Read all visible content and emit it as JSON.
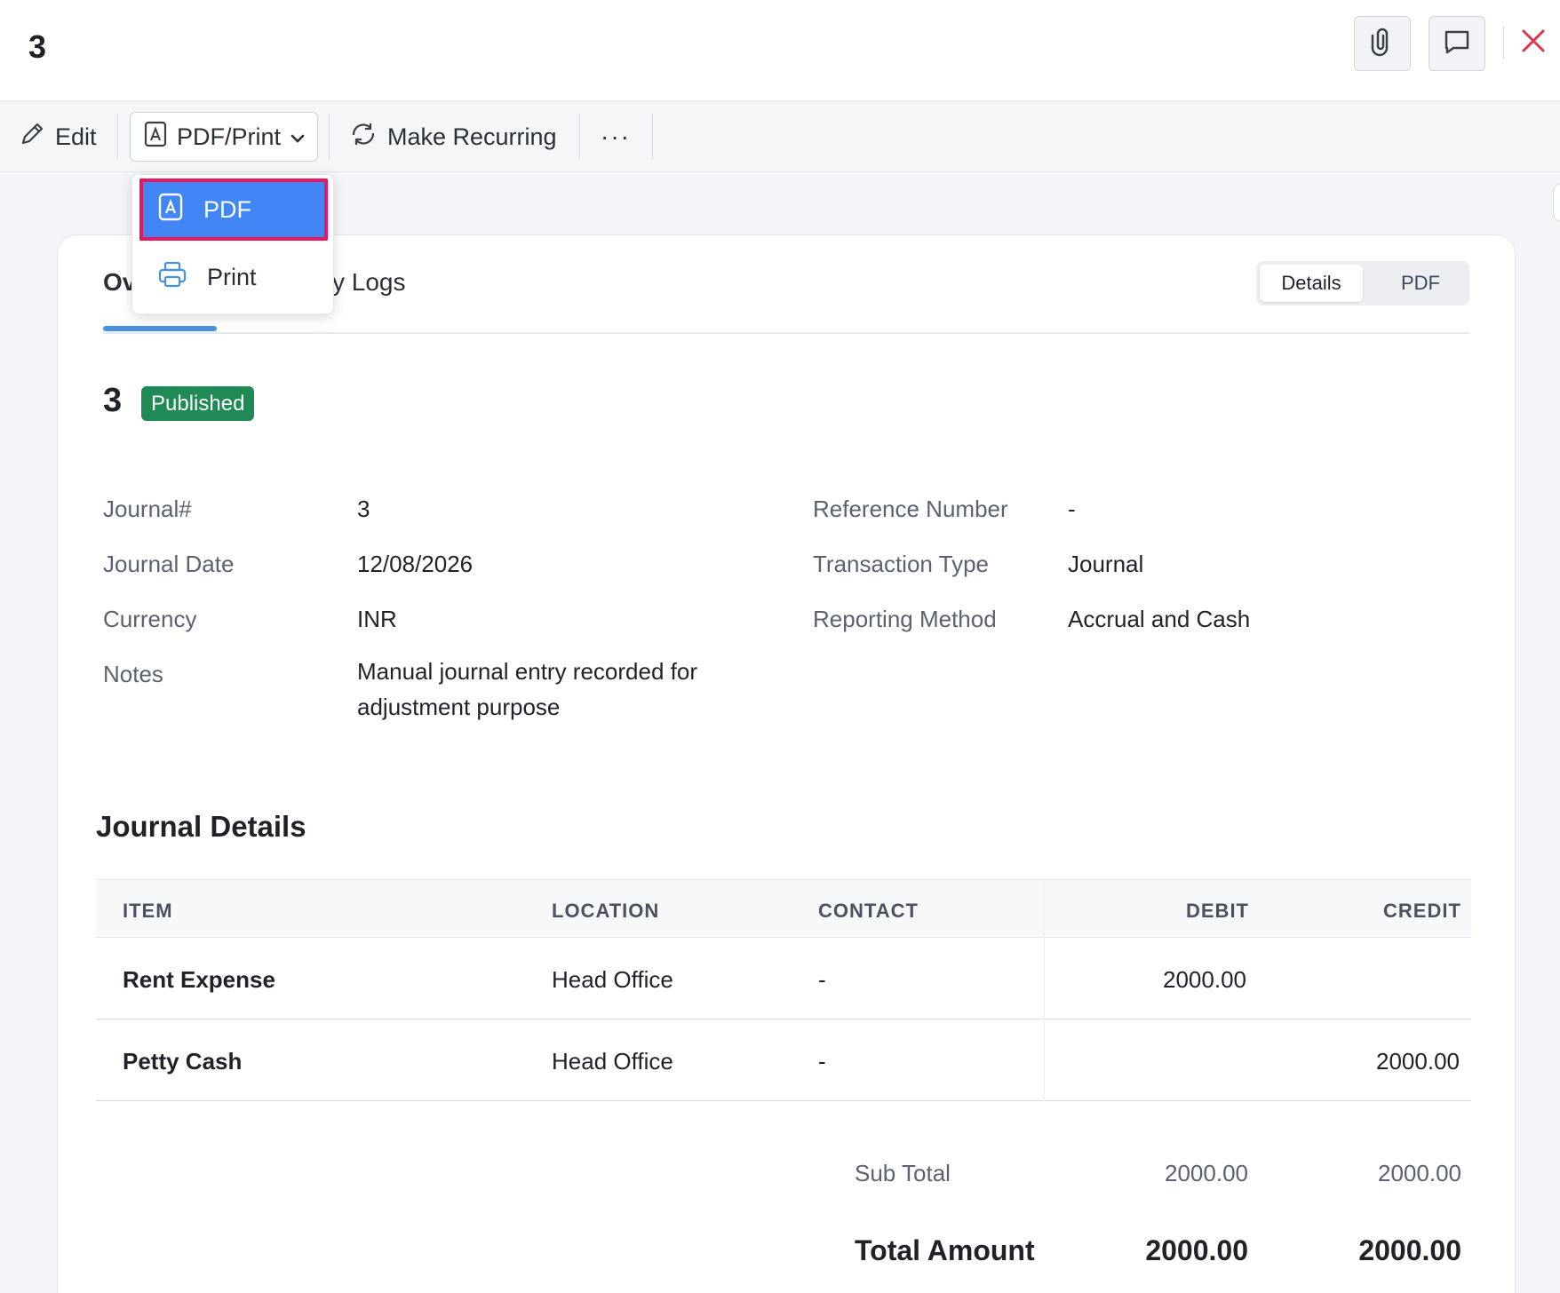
{
  "header": {
    "title": "3"
  },
  "toolbar": {
    "edit_label": "Edit",
    "pdf_print_label": "PDF/Print",
    "make_recurring_label": "Make Recurring",
    "more_label": "···"
  },
  "dropdown": {
    "items": [
      {
        "label": "PDF",
        "icon": "pdf-icon",
        "highlighted": true
      },
      {
        "label": "Print",
        "icon": "printer-icon",
        "highlighted": false
      }
    ]
  },
  "tabs": {
    "overview_partial": "Ov",
    "logs_partial": "y Logs"
  },
  "view_toggle": {
    "details": "Details",
    "pdf": "PDF",
    "selected": "Details"
  },
  "journal": {
    "number": "3",
    "status": "Published",
    "status_color": "#1f8a55",
    "fields_left": [
      {
        "label": "Journal#",
        "value": "3"
      },
      {
        "label": "Journal Date",
        "value": "12/08/2026"
      },
      {
        "label": "Currency",
        "value": "INR"
      },
      {
        "label": "Notes",
        "value": "Manual journal entry recorded for adjustment purpose"
      }
    ],
    "fields_right": [
      {
        "label": "Reference Number",
        "value": "-"
      },
      {
        "label": "Transaction Type",
        "value": "Journal"
      },
      {
        "label": "Reporting Method",
        "value": "Accrual and Cash"
      }
    ]
  },
  "details": {
    "title": "Journal Details",
    "columns": [
      "ITEM",
      "LOCATION",
      "CONTACT",
      "DEBIT",
      "CREDIT"
    ],
    "rows": [
      {
        "item": "Rent Expense",
        "location": "Head Office",
        "contact": "-",
        "debit": "2000.00",
        "credit": ""
      },
      {
        "item": "Petty Cash",
        "location": "Head Office",
        "contact": "-",
        "debit": "",
        "credit": "2000.00"
      }
    ],
    "subtotal": {
      "label": "Sub Total",
      "debit": "2000.00",
      "credit": "2000.00"
    },
    "total": {
      "label": "Total Amount",
      "debit": "2000.00",
      "credit": "2000.00"
    }
  },
  "colors": {
    "accent": "#4285f4",
    "highlight_border": "#e8175d",
    "close": "#e0344b"
  }
}
